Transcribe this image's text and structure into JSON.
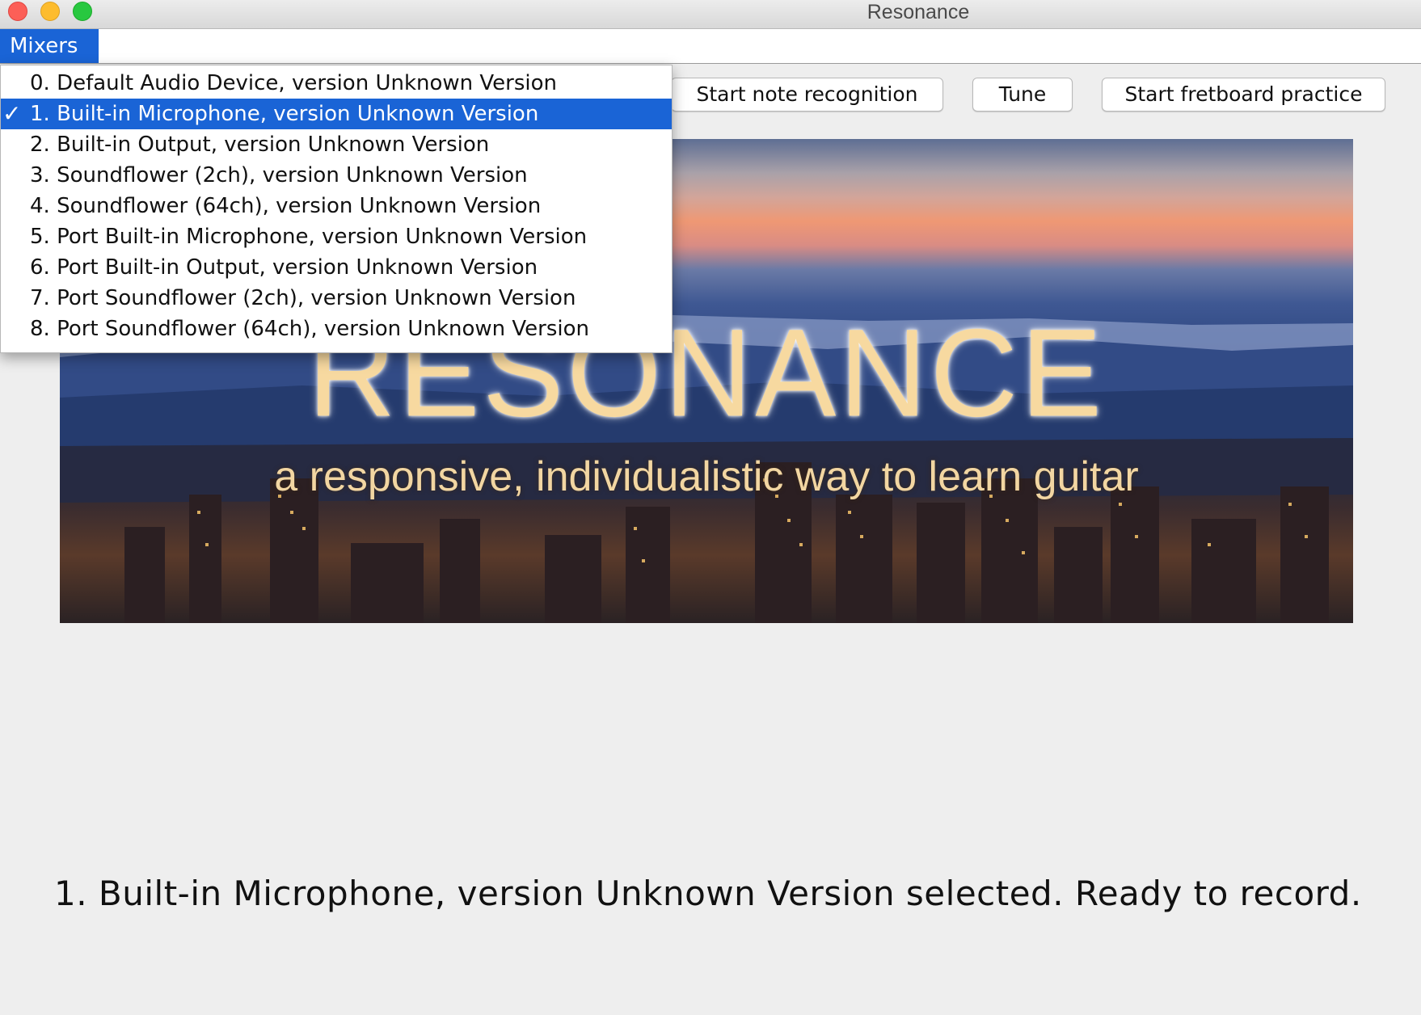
{
  "window": {
    "title": "Resonance"
  },
  "menubar": {
    "mixers_label": "Mixers"
  },
  "toolbar": {
    "note_recognition_label": "Start note recognition",
    "tune_label": "Tune",
    "fretboard_label": "Start fretboard practice"
  },
  "mixers_menu": {
    "items": [
      {
        "label": "0. Default Audio Device, version Unknown Version",
        "selected": false
      },
      {
        "label": "1. Built-in Microphone, version Unknown Version",
        "selected": true
      },
      {
        "label": "2. Built-in Output, version Unknown Version",
        "selected": false
      },
      {
        "label": "3. Soundflower (2ch), version Unknown Version",
        "selected": false
      },
      {
        "label": "4. Soundflower (64ch), version Unknown Version",
        "selected": false
      },
      {
        "label": "5. Port Built-in Microphone, version Unknown Version",
        "selected": false
      },
      {
        "label": "6. Port Built-in Output, version Unknown Version",
        "selected": false
      },
      {
        "label": "7. Port Soundflower (2ch), version Unknown Version",
        "selected": false
      },
      {
        "label": "8. Port Soundflower (64ch), version Unknown Version",
        "selected": false
      }
    ],
    "check_glyph": "✓"
  },
  "banner": {
    "title": "RESONANCE",
    "tagline": "a responsive, individualistic way to learn guitar"
  },
  "status": {
    "text": "1. Built-in Microphone, version Unknown Version selected. Ready to record."
  },
  "colors": {
    "accent": "#1a64d6",
    "banner_text": "#f7d9a0"
  },
  "icons": {
    "close": "close-icon",
    "minimize": "minimize-icon",
    "zoom": "zoom-icon",
    "check": "checkmark-icon"
  }
}
